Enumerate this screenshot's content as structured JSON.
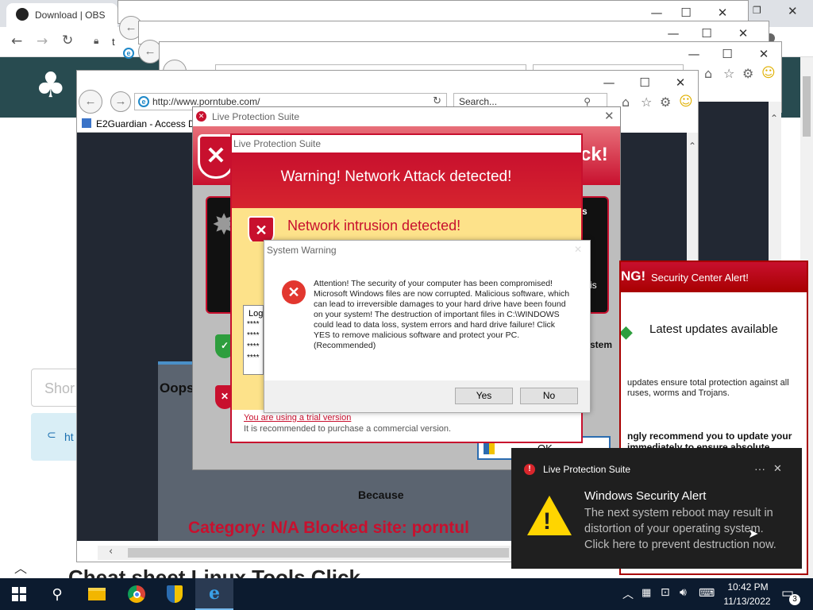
{
  "chrome": {
    "tab_title": "Download | OBS",
    "obs_heading_partial": "Sh",
    "obs_input_partial": "Shor",
    "obs_link_partial": "ht",
    "obs_bottom_partial": "Cheat sheet Linux Tools Click",
    "address_partial": "t"
  },
  "ie_front": {
    "url": "http://www.porntube.com/",
    "search_placeholder": "Search...",
    "tab_title": "E2Guardian - Access D"
  },
  "e2guardian": {
    "oops": "Oops",
    "because": "Because",
    "category_line": "Category: N/A  Blocked site: porntul",
    "ok_partial": "OK"
  },
  "lps_back": {
    "title": "Live Protection Suite",
    "banner_partial": "ck!",
    "side1": "s",
    "side2": "is",
    "side3": "stem"
  },
  "lps_front": {
    "title": "Live Protection Suite",
    "header": "Warning! Network Attack detected!",
    "intrusion": "Network intrusion detected!",
    "log_label": "Log",
    "log_rows": [
      "****",
      "****",
      "****",
      "****"
    ],
    "trial_link": "You are using a trial version",
    "recommend": "It is recommended to purchase a commercial version."
  },
  "system_warning": {
    "title": "System Warning",
    "message": "Attention! The security of your computer has been compromised! Microsoft Windows files are now corrupted. Malicious software, which can lead to irreversible damages to your hard drive have been found on your system! The destruction of important files in C:\\WINDOWS could lead to data loss, system errors and hard drive failure! Click YES to remove malicious software and protect your PC. (Recommended)",
    "yes": "Yes",
    "no": "No"
  },
  "security_center": {
    "header_bold": "NG!",
    "header_text": "Security Center Alert!",
    "heading": "Latest updates available",
    "body1": "updates ensure total protection against all",
    "body2": "ruses, worms and Trojans.",
    "bold1": "ngly recommend you to update your",
    "bold2": "immediately to ensure absolute"
  },
  "toast": {
    "app": "Live Protection Suite",
    "more": "···",
    "close": "✕",
    "title": "Windows Security Alert",
    "body": "The next system reboot may result in distortion of your operating system. Click here to prevent destruction now."
  },
  "taskbar": {
    "time": "10:42 PM",
    "date": "11/13/2022",
    "notif_count": "3"
  },
  "icons": [
    "windows-start-icon",
    "search-icon",
    "file-explorer-icon",
    "chrome-icon",
    "shield-icon",
    "ie-icon",
    "chevron-up-icon",
    "network-icon",
    "volume-icon",
    "keyboard-icon",
    "notification-icon"
  ],
  "colors": {
    "alert_red": "#c8102e",
    "dark_red": "#a80000",
    "warn_yellow": "#fde28a",
    "taskbar": "#0c1b2f",
    "toast_bg": "#1f1f1f"
  }
}
